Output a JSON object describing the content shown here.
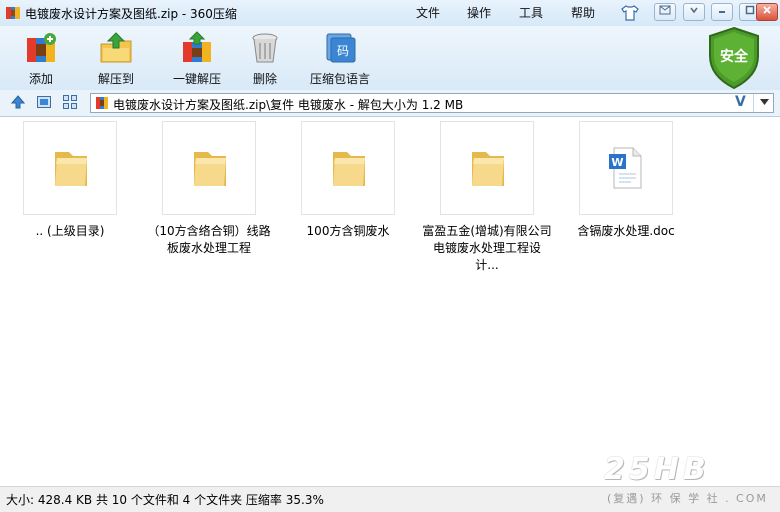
{
  "window": {
    "title": "电镀废水设计方案及图纸.zip - 360压缩",
    "menus": [
      "文件",
      "操作",
      "工具",
      "帮助"
    ]
  },
  "toolbar": {
    "items": [
      {
        "label": "添加",
        "icon": "add-archive-icon"
      },
      {
        "label": "解压到",
        "icon": "extract-to-icon"
      },
      {
        "label": "一键解压",
        "icon": "one-click-extract-icon"
      },
      {
        "label": "删除",
        "icon": "delete-icon"
      },
      {
        "label": "压缩包语言",
        "icon": "archive-language-icon"
      }
    ],
    "badge_label": "安全"
  },
  "address": {
    "path": "电镀废水设计方案及图纸.zip\\复件 电镀废水 - 解包大小为 1.2 MB",
    "verified_mark": "V"
  },
  "files": [
    {
      "name": ".. (上级目录)",
      "type": "folder"
    },
    {
      "name": "（10方含络合铜）线路板废水处理工程",
      "type": "folder"
    },
    {
      "name": "100方含铜废水",
      "type": "folder"
    },
    {
      "name": "富盈五金(增城)有限公司电镀废水处理工程设计...",
      "type": "folder"
    },
    {
      "name": "含镉废水处理.doc",
      "type": "word-document"
    }
  ],
  "status": {
    "text": "大小: 428.4 KB 共 10 个文件和 4 个文件夹 压缩率 35.3%"
  },
  "watermark": {
    "logo": "25HB",
    "subtitle": "(复遇) 环 保 学 社 . COM"
  },
  "colors": {
    "titlebar": "#dbeaf8",
    "folder": "#f3d27a",
    "shield": "#4c9a2a",
    "link_blue": "#3a6ea8"
  }
}
